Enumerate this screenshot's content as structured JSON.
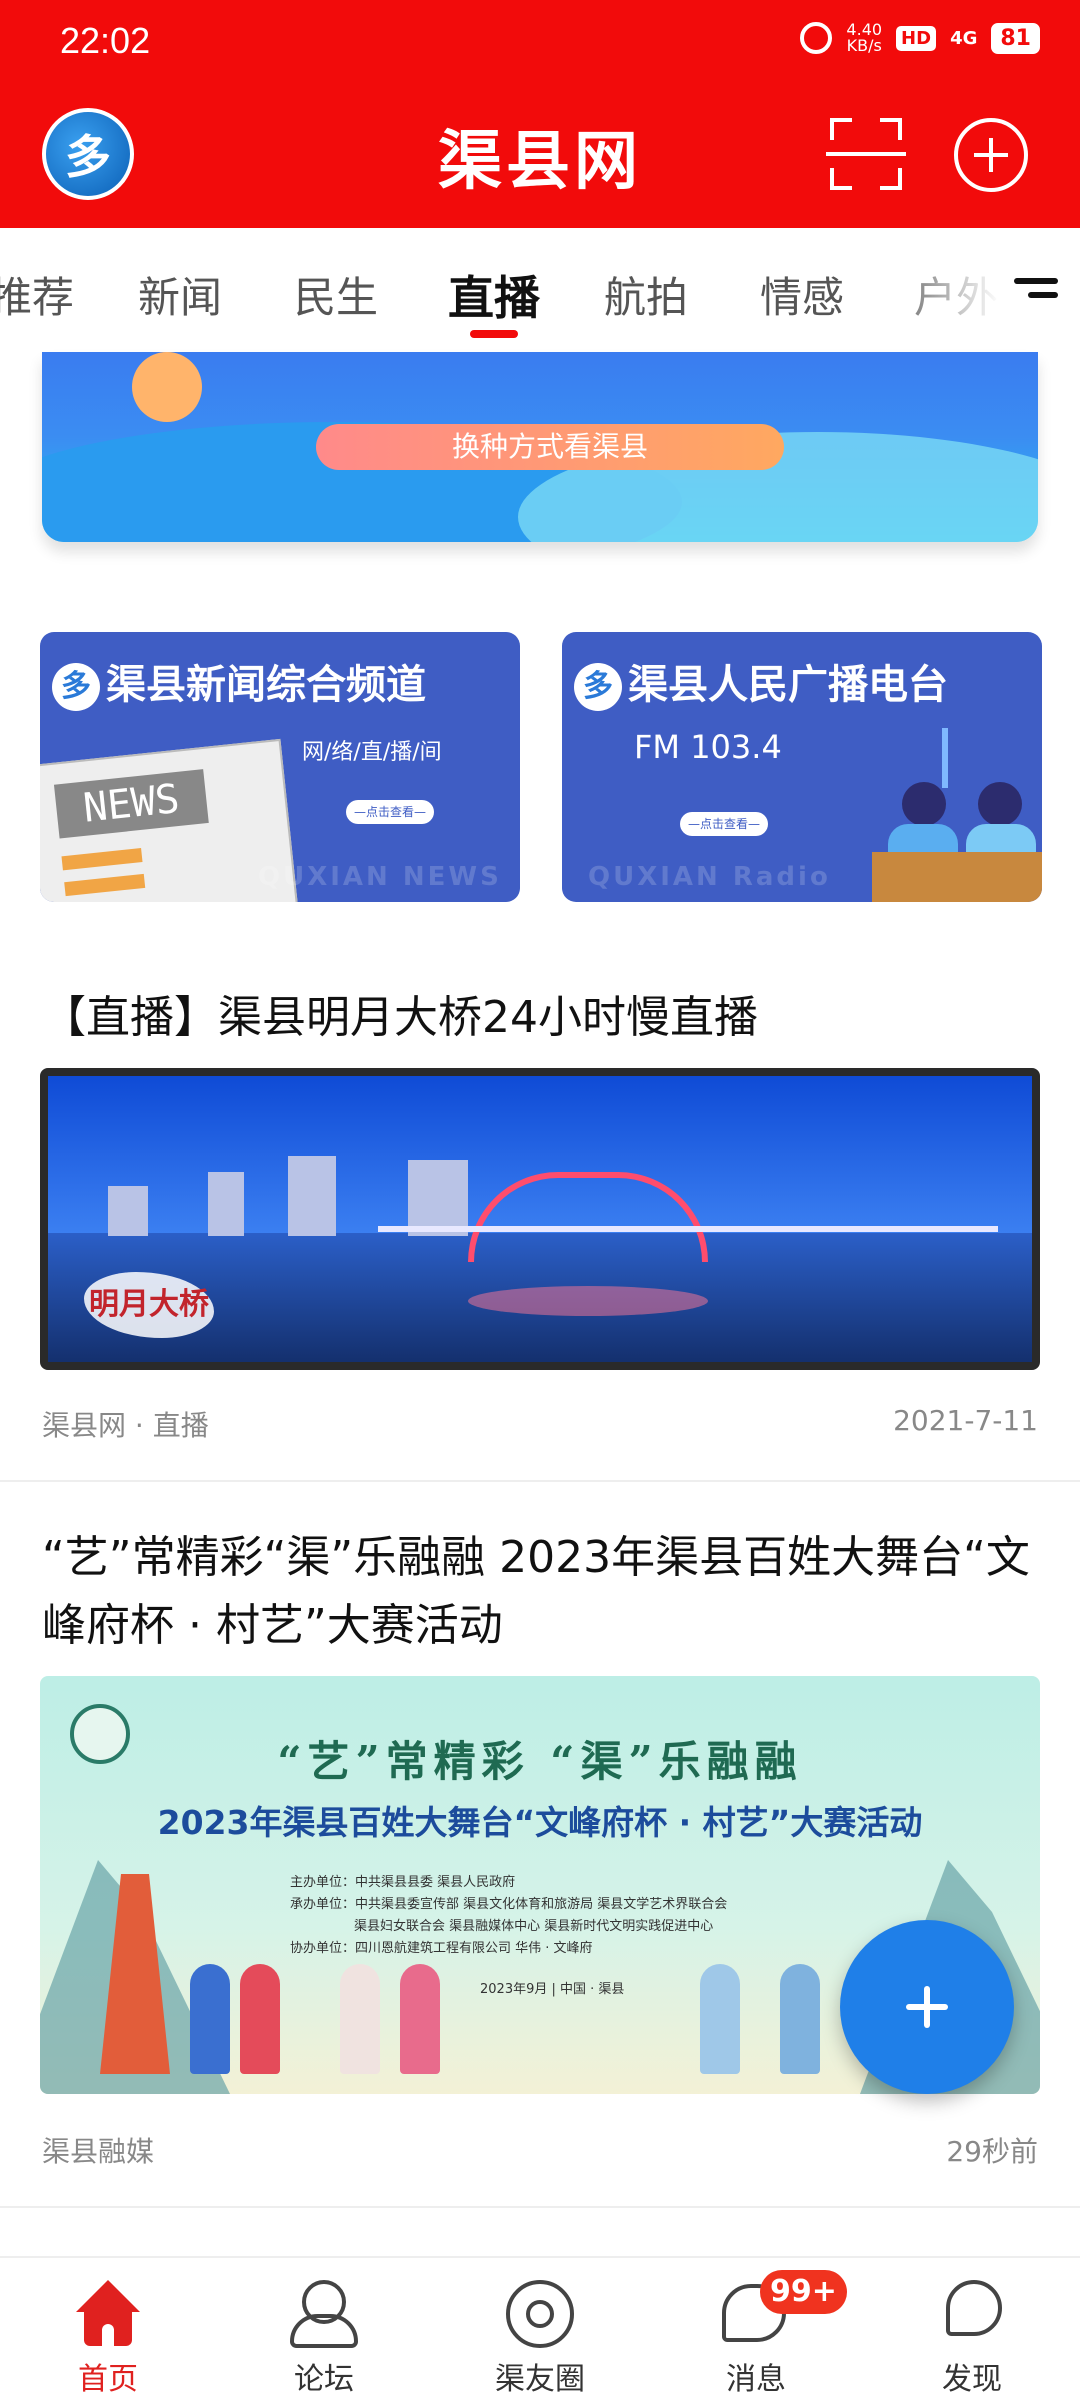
{
  "status_bar": {
    "time": "22:02",
    "net_speed": "4.40",
    "net_unit": "KB/s",
    "hd": "HD",
    "signal": "4G",
    "battery": "81"
  },
  "header": {
    "logo_glyph": "多",
    "title": "渠县网"
  },
  "tabs": [
    {
      "label": "推荐"
    },
    {
      "label": "新闻"
    },
    {
      "label": "民生"
    },
    {
      "label": "直播",
      "active": true
    },
    {
      "label": "航拍"
    },
    {
      "label": "情感"
    },
    {
      "label": "户外"
    }
  ],
  "banner": {
    "button_text": "换种方式看渠县"
  },
  "channels": [
    {
      "title": "渠县新闻综合频道",
      "subtitle": "网/络/直/播/间",
      "button": "—点击查看—",
      "watermark": "QUXIAN NEWS",
      "paper_word": "NEWS"
    },
    {
      "title": "渠县人民广播电台",
      "subtitle": "FM 103.4",
      "button": "—点击查看—",
      "watermark": "QUXIAN Radio"
    }
  ],
  "articles": [
    {
      "title": "【直播】渠县明月大桥24小时慢直播",
      "image_caption": "明月大桥",
      "source": "渠县网 · 直播",
      "time": "2021-7-11"
    },
    {
      "title": "“艺”常精彩“渠”乐融融 2023年渠县百姓大舞台“文峰府杯 · 村艺”大赛活动",
      "image_heading1": "“艺”常精彩 “渠”乐融融",
      "image_heading2": "2023年渠县百姓大舞台“文峰府杯 · 村艺”大赛活动",
      "image_info": [
        "主办单位：中共渠县县委  渠县人民政府",
        "承办单位：中共渠县委宣传部  渠县文化体育和旅游局  渠县文学艺术界联合会",
        "渠县妇女联合会  渠县融媒体中心  渠县新时代文明实践促进中心",
        "协办单位：四川恩航建筑工程有限公司  华伟 · 文峰府"
      ],
      "image_date": "2023年9月 | 中国 · 渠县",
      "source": "渠县融媒",
      "time": "29秒前"
    }
  ],
  "bottom_nav": [
    {
      "label": "首页",
      "icon": "home-icon",
      "active": true
    },
    {
      "label": "论坛",
      "icon": "forum-icon"
    },
    {
      "label": "渠友圈",
      "icon": "moments-icon"
    },
    {
      "label": "消息",
      "icon": "message-icon",
      "badge": "99+"
    },
    {
      "label": "发现",
      "icon": "discover-icon"
    }
  ],
  "colors": {
    "brand_red": "#f20b0b",
    "fab_blue": "#1f7fe8",
    "channel_blue": "#3f5dc4"
  }
}
